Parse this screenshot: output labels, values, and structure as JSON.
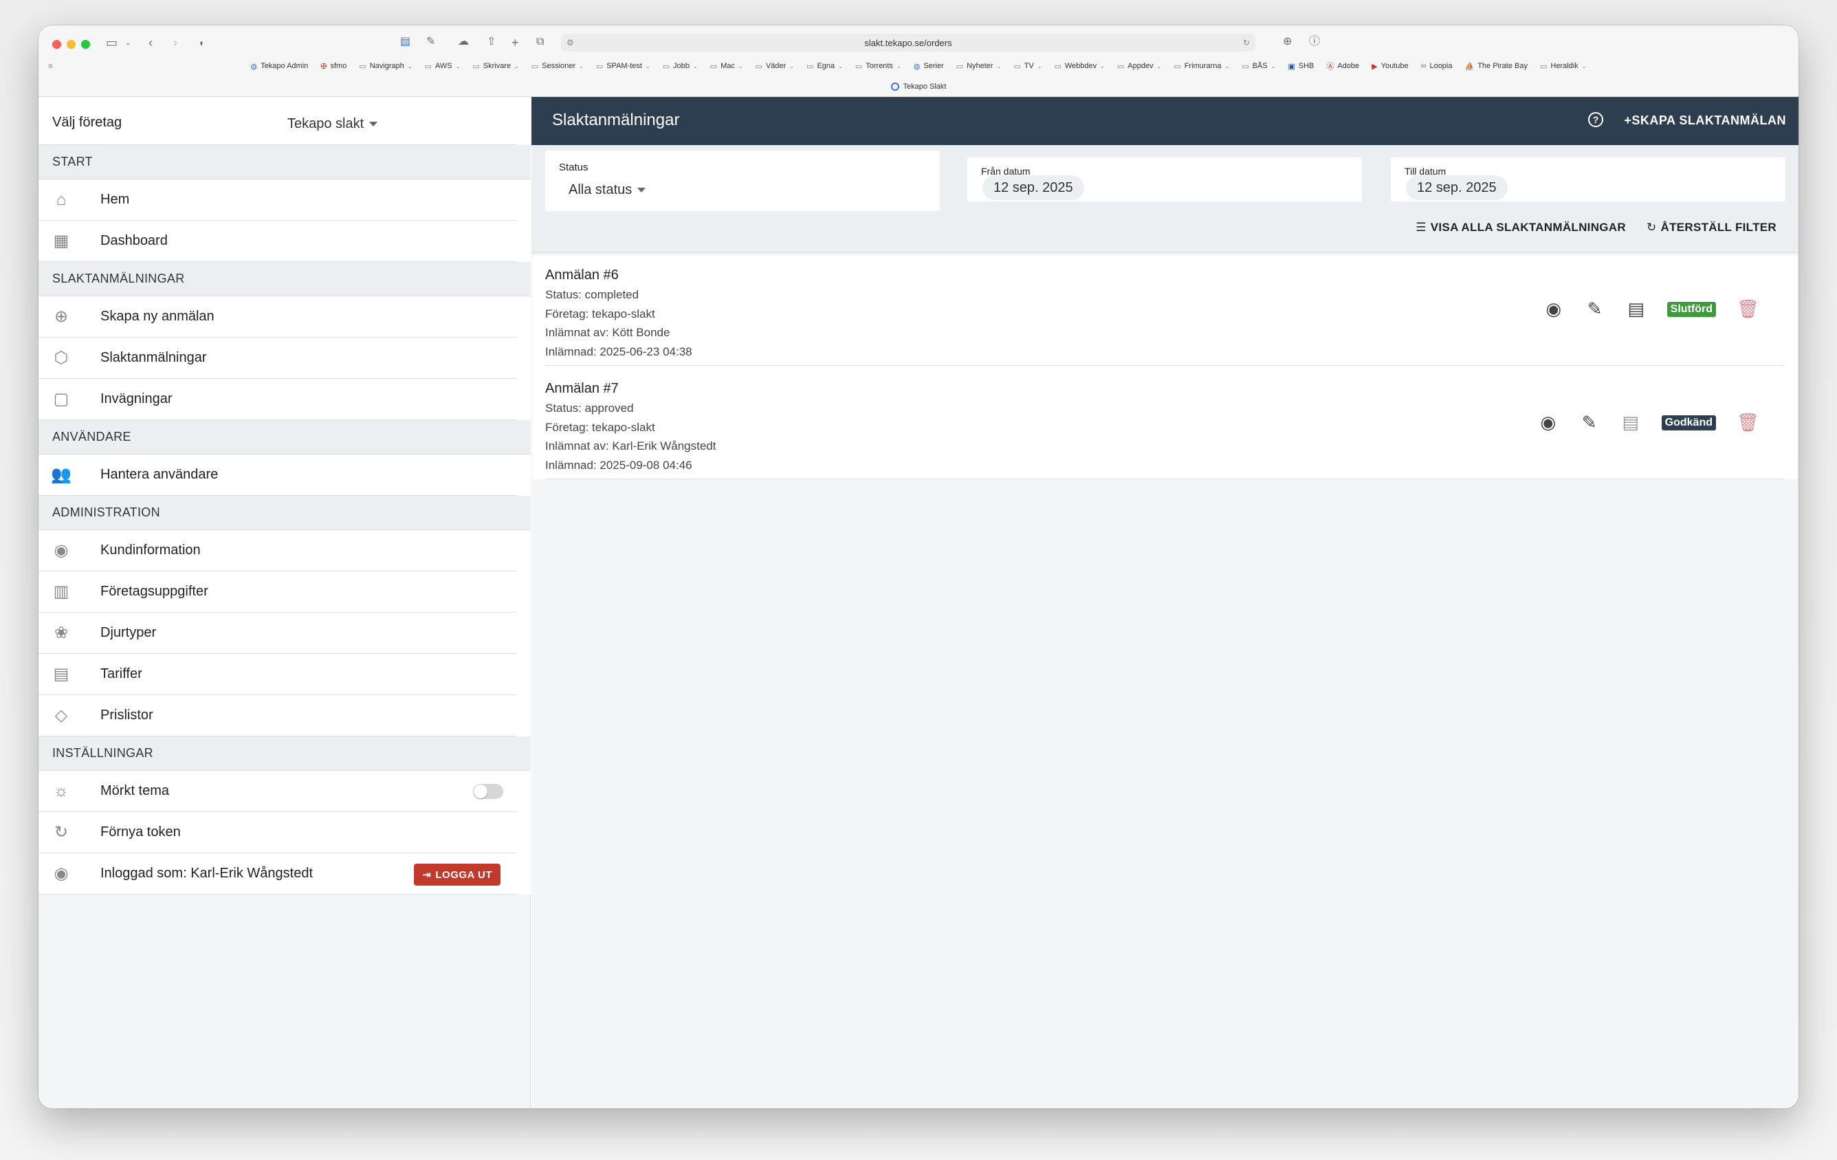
{
  "browser": {
    "url": "slakt.tekapo.se/orders",
    "bookmarks": [
      {
        "label": "Tekapo Admin",
        "icon": "globe-icon"
      },
      {
        "label": "sfmo",
        "icon": "cross-icon"
      },
      {
        "label": "Navigraph",
        "icon": "folder-icon"
      },
      {
        "label": "AWS",
        "icon": "folder-icon"
      },
      {
        "label": "Skrivare",
        "icon": "folder-icon"
      },
      {
        "label": "Sessioner",
        "icon": "folder-icon"
      },
      {
        "label": "SPAM-test",
        "icon": "folder-icon"
      },
      {
        "label": "Jobb",
        "icon": "folder-icon"
      },
      {
        "label": "Mac",
        "icon": "folder-icon"
      },
      {
        "label": "Väder",
        "icon": "folder-icon"
      },
      {
        "label": "Egna",
        "icon": "folder-icon"
      },
      {
        "label": "Torrents",
        "icon": "folder-icon"
      },
      {
        "label": "Serier",
        "icon": "globe-icon"
      },
      {
        "label": "Nyheter",
        "icon": "folder-icon"
      },
      {
        "label": "TV",
        "icon": "folder-icon"
      },
      {
        "label": "Webbdev",
        "icon": "folder-icon"
      },
      {
        "label": "Appdev",
        "icon": "folder-icon"
      },
      {
        "label": "Frimurarna",
        "icon": "folder-icon"
      },
      {
        "label": "BÅS",
        "icon": "folder-icon"
      },
      {
        "label": "SHB",
        "icon": "bank-icon"
      },
      {
        "label": "Adobe",
        "icon": "adobe-icon"
      },
      {
        "label": "Youtube",
        "icon": "youtube-icon"
      },
      {
        "label": "Loopia",
        "icon": "loopia-icon"
      },
      {
        "label": "The Pirate Bay",
        "icon": "ship-icon"
      },
      {
        "label": "Heraldik",
        "icon": "folder-icon"
      }
    ],
    "tab_title": "Tekapo Slakt"
  },
  "sidebar": {
    "company_label": "Välj företag",
    "company_value": "Tekapo slakt",
    "sections": [
      {
        "heading": "START",
        "items": [
          {
            "label": "Hem",
            "icon": "home-icon"
          },
          {
            "label": "Dashboard",
            "icon": "dashboard-icon"
          }
        ]
      },
      {
        "heading": "SLAKTANMÄLNINGAR",
        "items": [
          {
            "label": "Skapa ny anmälan",
            "icon": "plus-circle-icon"
          },
          {
            "label": "Slaktanmälningar",
            "icon": "box-icon"
          },
          {
            "label": "Invägningar",
            "icon": "scale-icon"
          }
        ]
      },
      {
        "heading": "ANVÄNDARE",
        "items": [
          {
            "label": "Hantera användare",
            "icon": "users-icon"
          }
        ]
      },
      {
        "heading": "ADMINISTRATION",
        "items": [
          {
            "label": "Kundinformation",
            "icon": "user-circle-icon"
          },
          {
            "label": "Företagsuppgifter",
            "icon": "building-icon"
          },
          {
            "label": "Djurtyper",
            "icon": "paw-icon"
          },
          {
            "label": "Tariffer",
            "icon": "calculator-icon"
          },
          {
            "label": "Prislistor",
            "icon": "tag-icon"
          }
        ]
      },
      {
        "heading": "INSTÄLLNINGAR",
        "items": [
          {
            "label": "Mörkt tema",
            "icon": "sun-icon"
          },
          {
            "label": "Förnya token",
            "icon": "refresh-icon"
          },
          {
            "label": "Inloggad som: Karl-Erik Wångstedt",
            "icon": "user-circle-icon"
          }
        ]
      }
    ],
    "logout_label": "LOGGA UT"
  },
  "main": {
    "title": "Slaktanmälningar",
    "create_label": "SKAPA SLAKTANMÄLAN",
    "filters": {
      "status_label": "Status",
      "status_value": "Alla status",
      "from_label": "Från datum",
      "from_value": "12 sep. 2025",
      "to_label": "Till datum",
      "to_value": "12 sep. 2025"
    },
    "show_all_label": "VISA ALLA SLAKTANMÄLNINGAR",
    "reset_label": "ÅTERSTÄLL FILTER",
    "orders": [
      {
        "title": "Anmälan #6",
        "status": "Status: completed",
        "company": "Företag: tekapo-slakt",
        "submitted_by": "Inlämnat av: Kött Bonde",
        "submitted_at": "Inlämnad: 2025-06-23 04:38",
        "badge": "Slutförd",
        "badge_color": "#3c9a3c"
      },
      {
        "title": "Anmälan #7",
        "status": "Status: approved",
        "company": "Företag: tekapo-slakt",
        "submitted_by": "Inlämnat av: Karl-Erik Wångstedt",
        "submitted_at": "Inlämnad: 2025-09-08 04:46",
        "badge": "Godkänd",
        "badge_color": "#2c3e50"
      }
    ]
  },
  "colors": {
    "topbar": "#2c3e50",
    "logout": "#c0392b",
    "badge_completed": "#3c9a3c",
    "badge_approved": "#2c3e50"
  }
}
